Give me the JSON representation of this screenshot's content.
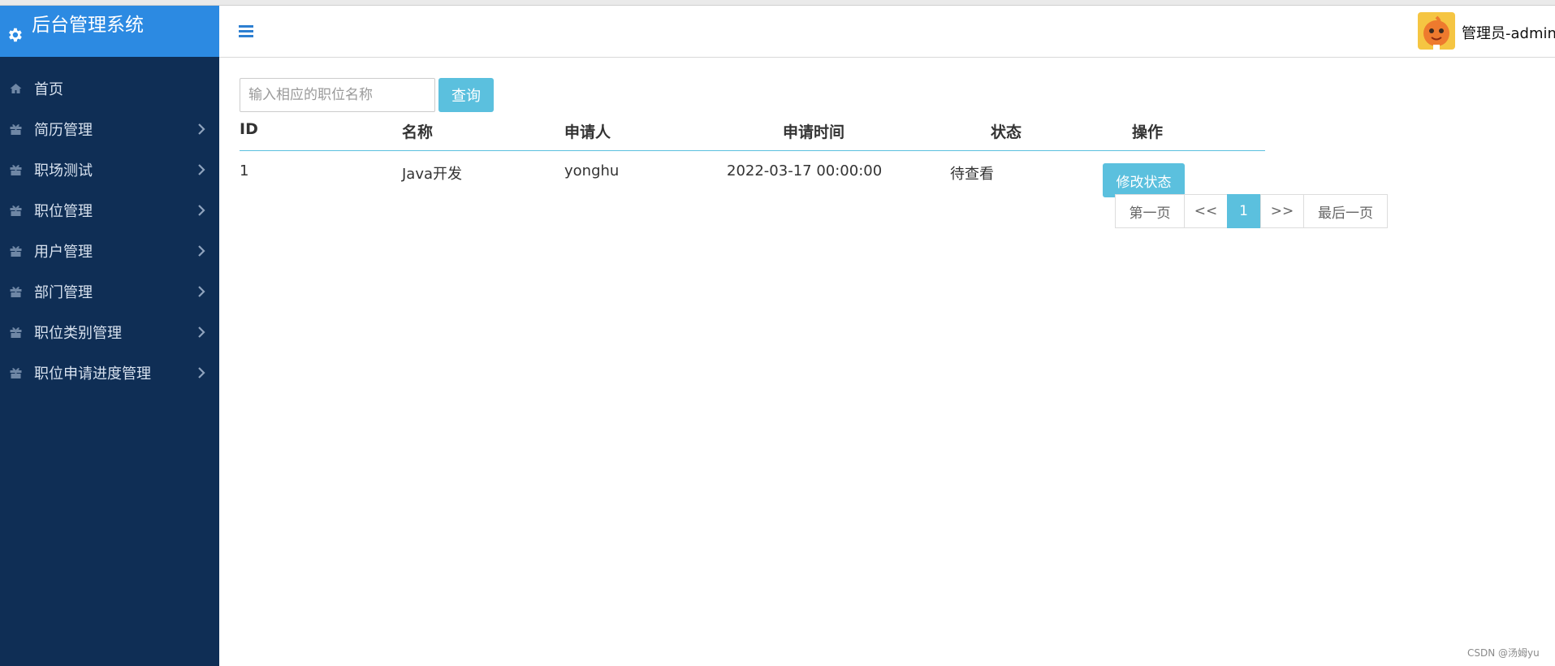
{
  "app": {
    "title": "后台管理系统"
  },
  "sidebar": {
    "items": [
      {
        "label": "首页",
        "icon": "home-icon",
        "has_submenu": false
      },
      {
        "label": "简历管理",
        "icon": "gift-icon",
        "has_submenu": true
      },
      {
        "label": "职场测试",
        "icon": "gift-icon",
        "has_submenu": true
      },
      {
        "label": "职位管理",
        "icon": "gift-icon",
        "has_submenu": true
      },
      {
        "label": "用户管理",
        "icon": "gift-icon",
        "has_submenu": true
      },
      {
        "label": "部门管理",
        "icon": "gift-icon",
        "has_submenu": true
      },
      {
        "label": "职位类别管理",
        "icon": "gift-icon",
        "has_submenu": true
      },
      {
        "label": "职位申请进度管理",
        "icon": "gift-icon",
        "has_submenu": true
      }
    ]
  },
  "header": {
    "user_label": "管理员-admin"
  },
  "search": {
    "placeholder": "输入相应的职位名称",
    "value": "",
    "button_label": "查询"
  },
  "table": {
    "columns": [
      "ID",
      "名称",
      "申请人",
      "申请时间",
      "状态",
      "操作"
    ],
    "rows": [
      {
        "id": "1",
        "name": "Java开发",
        "applicant": "yonghu",
        "time": "2022-03-17 00:00:00",
        "status": "待查看",
        "action_label": "修改状态"
      }
    ]
  },
  "pagination": {
    "first": "第一页",
    "prev": "<<",
    "current": "1",
    "next": ">>",
    "last": "最后一页"
  },
  "watermark": "CSDN @汤姆yu",
  "colors": {
    "sidebar_bg": "#0f2e55",
    "brand_bg": "#2c8ae2",
    "accent": "#5bc0de"
  }
}
